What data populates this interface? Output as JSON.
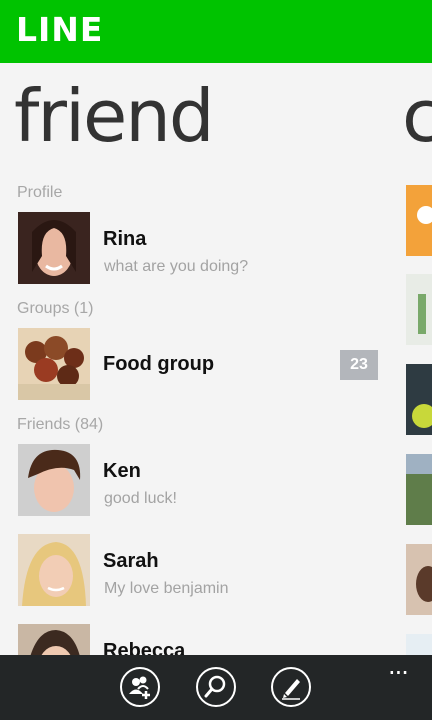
{
  "app": {
    "logo": "LINE"
  },
  "pivot": {
    "current": "friend",
    "next_peek": "c"
  },
  "sections": {
    "profile": "Profile",
    "groups": "Groups (1)",
    "friends": "Friends (84)"
  },
  "profile": {
    "name": "Rina",
    "status": "what are you doing?"
  },
  "groups": [
    {
      "name": "Food group",
      "badge": "23"
    }
  ],
  "friends": [
    {
      "name": "Ken",
      "status": "good luck!"
    },
    {
      "name": "Sarah",
      "status": "My love benjamin"
    },
    {
      "name": "Rebecca",
      "status": ""
    }
  ],
  "appbar": {
    "buttons": [
      "add-friend-icon",
      "search-icon",
      "compose-icon"
    ],
    "more": "..."
  },
  "colors": {
    "brand": "#00c300",
    "appbar": "#232627",
    "badge": "#b3b6bb"
  }
}
